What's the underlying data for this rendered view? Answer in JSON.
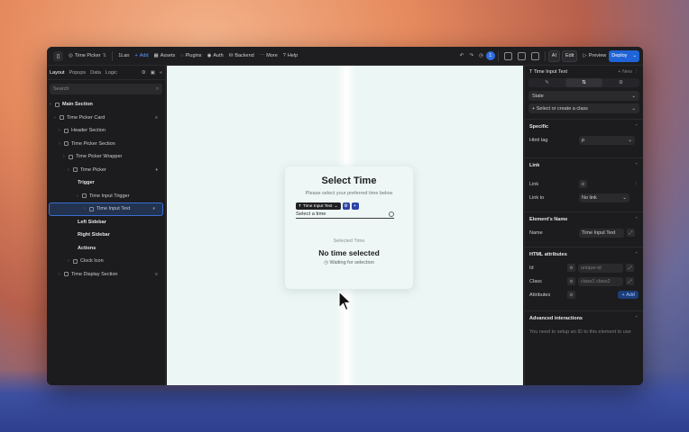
{
  "topbar": {
    "app_name": "Time Picker",
    "breakpoint": "1Lan",
    "add_label": "Add",
    "assets_label": "Assets",
    "plugins_label": "Plugins",
    "auth_label": "Auth",
    "backend_label": "Backend",
    "more_label": "More",
    "help_label": "Help",
    "ai_label": "AI",
    "edit_label": "Edit",
    "preview_label": "Preview",
    "deploy_label": "Deploy",
    "avatar_initial": "1"
  },
  "left": {
    "tabs": [
      "Layout",
      "Popups",
      "Data",
      "Logic"
    ],
    "search_placeholder": "Search",
    "tree": [
      {
        "label": "Main Section",
        "indent": 0,
        "bold": true,
        "badge": ""
      },
      {
        "label": "Time Picker Card",
        "indent": 1,
        "bold": false,
        "badge": "≡"
      },
      {
        "label": "Header Section",
        "indent": 2,
        "bold": false,
        "badge": ""
      },
      {
        "label": "Time Picker Section",
        "indent": 2,
        "bold": false,
        "badge": ""
      },
      {
        "label": "Time Picker Wrapper",
        "indent": 3,
        "bold": false,
        "badge": ""
      },
      {
        "label": "Time Picker",
        "indent": 4,
        "bold": false,
        "badge": "♦"
      },
      {
        "label": "Trigger",
        "indent": 5,
        "bold": true,
        "badge": ""
      },
      {
        "label": "Time Input Trigger",
        "indent": 6,
        "bold": false,
        "badge": ""
      },
      {
        "label": "Time Input Text",
        "indent": 7,
        "bold": false,
        "badge": "♦",
        "selected": true
      },
      {
        "label": "Left Sidebar",
        "indent": 5,
        "bold": true,
        "badge": ""
      },
      {
        "label": "Right Sidebar",
        "indent": 5,
        "bold": true,
        "badge": ""
      },
      {
        "label": "Actions",
        "indent": 5,
        "bold": true,
        "badge": ""
      },
      {
        "label": "Clock Icon",
        "indent": 4,
        "bold": false,
        "badge": ""
      },
      {
        "label": "Time Display Section",
        "indent": 2,
        "bold": false,
        "badge": "≡"
      }
    ]
  },
  "canvas": {
    "title": "Select Time",
    "subtitle": "Please select your preferred time below",
    "chip_label": "Time Input Text",
    "input_placeholder": "Select a time",
    "selected_label": "Selected Time",
    "selected_value": "No time selected",
    "status": "Waiting for selection"
  },
  "right": {
    "element_title": "Time Input Text",
    "new_label": "New",
    "state_label": "State",
    "class_placeholder": "Select or create a class",
    "specific_label": "Specific",
    "html_tag_label": "Html tag",
    "html_tag_value": "p",
    "link_section": "Link",
    "link_label": "Link",
    "link_to_label": "Link to",
    "link_to_value": "No link",
    "element_name_section": "Element's Name",
    "name_label": "Name",
    "name_value": "Time Input Text",
    "html_attrs_section": "HTML attributes",
    "id_label": "Id",
    "id_placeholder": "unique-id",
    "class_label": "Class",
    "class_value_placeholder": "class1 class2",
    "attributes_label": "Attributes",
    "add_label": "Add",
    "advanced_section": "Advanced interactions",
    "advanced_hint": "You need to setup an ID to this element to use"
  }
}
